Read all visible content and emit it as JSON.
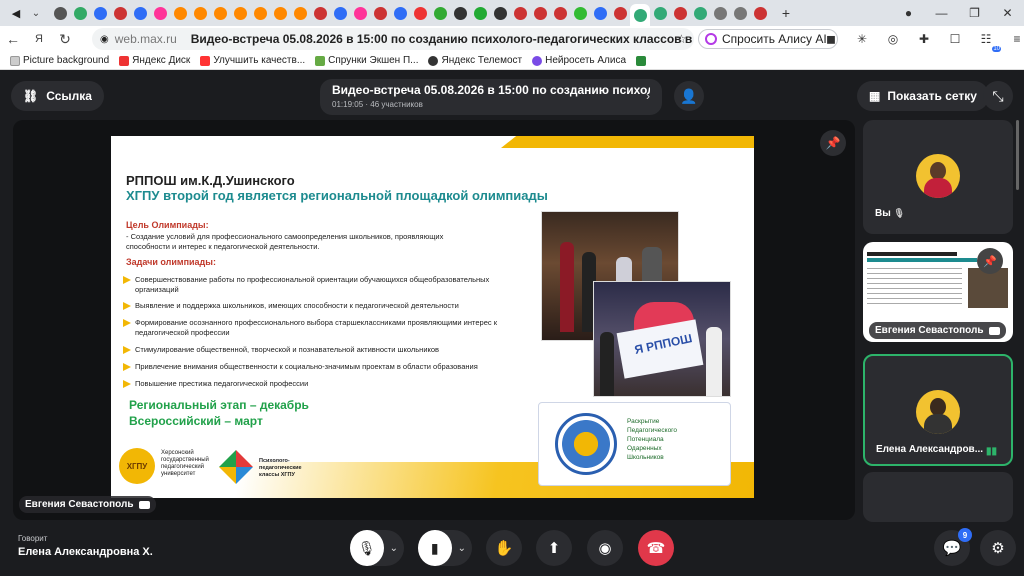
{
  "browser": {
    "tab_favicons": [
      "#555",
      "#3a6",
      "#2f6df6",
      "#c33",
      "#2f6df6",
      "#f39",
      "#f80",
      "#f80",
      "#f80",
      "#f80",
      "#f80",
      "#f80",
      "#f80",
      "#c33",
      "#2f6df6",
      "#f39",
      "#c33",
      "#2f6df6",
      "#e33",
      "#3a3",
      "#333",
      "#2a3",
      "#333",
      "#c33",
      "#c33",
      "#c33",
      "#3b3",
      "#2f6df6",
      "#c33",
      "#3a7",
      "#3a7",
      "#c33",
      "#3a7",
      "#777",
      "#777",
      "#c33"
    ],
    "url_host": "web.max.ru",
    "page_title": "Видео-встреча 05.08.2026 в 15:00 по созданию психолого-педагогических классов в ОО ХО —...",
    "alisa_label": "Спросить Алису AI",
    "ext_badge": "10",
    "bookmarks": [
      "Picture background",
      "Яндекс Диск",
      "Улучшить качеств...",
      "Спрунки Экшен П...",
      "Яндекс Телемост",
      "Нейросеть Алиса"
    ]
  },
  "call": {
    "link_label": "Ссылка",
    "title": "Видео-встреча 05.08.2026 в 15:00 по созданию психолог...",
    "subtitle": "01:19:05 · 46 участников",
    "grid_label": "Показать сетку",
    "stage_owner": "Евгения Севастополь",
    "speaking_label": "Говорит",
    "speaking_name": "Елена Александровна Х.",
    "chat_badge": "9"
  },
  "slide": {
    "school": "РППОШ им.К.Д.Ушинского",
    "headline": "ХГПУ второй год является региональной площадкой олимпиады",
    "goal_title": "Цель Олимпиады:",
    "goal_text": "-  Создание условий для профессионального самоопределения школьников, проявляющих способности и интерес к педагогической деятельности.",
    "tasks_title": "Задачи олимпиады:",
    "tasks": [
      "Совершенствование работы по профессиональной ориентации обучающихся общеобразовательных организаций",
      "Выявление и поддержка школьников, имеющих способности к педагогической деятельности",
      "Формирование осознанного профессионального выбора старшеклассниками проявляющими интерес к педагогической профессии",
      "Стимулирование общественной, творческой и познавательной активности школьников",
      "Привлечение внимания общественности к социально-значимым проектам в области образования",
      "Повышение престижа педагогической профессии"
    ],
    "stage1": "Региональный этап – декабрь",
    "stage2": "Всероссийский – март",
    "uni_logo": "ХГПУ",
    "uni_name": "Херсонский государственный педагогический университет",
    "classes_name": "Психолого-педагогические классы ХГПУ",
    "rppos_lines": [
      "Раскрытие",
      "Педагогического",
      "Потенциала",
      "Одаренных",
      "Школьников"
    ],
    "photo_sign": "Я РППОШ"
  },
  "participants": [
    {
      "name": "Вы",
      "muted": true
    },
    {
      "name": "Евгения Севастополь",
      "screen": true
    },
    {
      "name": "Елена Александров...",
      "speaking": true
    }
  ]
}
